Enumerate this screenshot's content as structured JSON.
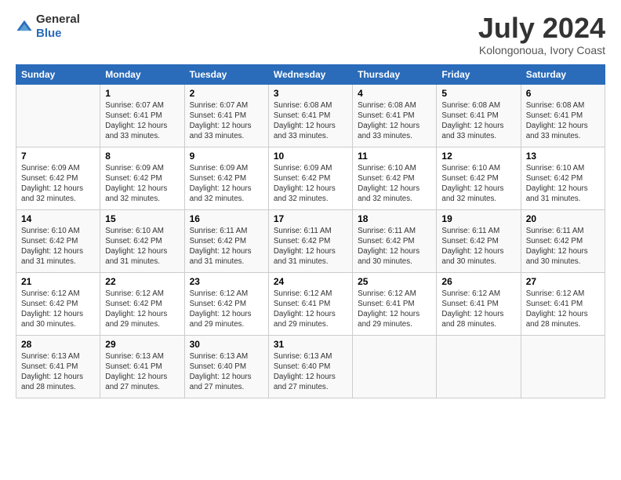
{
  "header": {
    "logo_general": "General",
    "logo_blue": "Blue",
    "title": "July 2024",
    "subtitle": "Kolongonoua, Ivory Coast"
  },
  "days_of_week": [
    "Sunday",
    "Monday",
    "Tuesday",
    "Wednesday",
    "Thursday",
    "Friday",
    "Saturday"
  ],
  "weeks": [
    [
      {
        "day": "",
        "sunrise": "",
        "sunset": "",
        "daylight": ""
      },
      {
        "day": "1",
        "sunrise": "Sunrise: 6:07 AM",
        "sunset": "Sunset: 6:41 PM",
        "daylight": "Daylight: 12 hours and 33 minutes."
      },
      {
        "day": "2",
        "sunrise": "Sunrise: 6:07 AM",
        "sunset": "Sunset: 6:41 PM",
        "daylight": "Daylight: 12 hours and 33 minutes."
      },
      {
        "day": "3",
        "sunrise": "Sunrise: 6:08 AM",
        "sunset": "Sunset: 6:41 PM",
        "daylight": "Daylight: 12 hours and 33 minutes."
      },
      {
        "day": "4",
        "sunrise": "Sunrise: 6:08 AM",
        "sunset": "Sunset: 6:41 PM",
        "daylight": "Daylight: 12 hours and 33 minutes."
      },
      {
        "day": "5",
        "sunrise": "Sunrise: 6:08 AM",
        "sunset": "Sunset: 6:41 PM",
        "daylight": "Daylight: 12 hours and 33 minutes."
      },
      {
        "day": "6",
        "sunrise": "Sunrise: 6:08 AM",
        "sunset": "Sunset: 6:41 PM",
        "daylight": "Daylight: 12 hours and 33 minutes."
      }
    ],
    [
      {
        "day": "7",
        "sunrise": "Sunrise: 6:09 AM",
        "sunset": "Sunset: 6:42 PM",
        "daylight": "Daylight: 12 hours and 32 minutes."
      },
      {
        "day": "8",
        "sunrise": "Sunrise: 6:09 AM",
        "sunset": "Sunset: 6:42 PM",
        "daylight": "Daylight: 12 hours and 32 minutes."
      },
      {
        "day": "9",
        "sunrise": "Sunrise: 6:09 AM",
        "sunset": "Sunset: 6:42 PM",
        "daylight": "Daylight: 12 hours and 32 minutes."
      },
      {
        "day": "10",
        "sunrise": "Sunrise: 6:09 AM",
        "sunset": "Sunset: 6:42 PM",
        "daylight": "Daylight: 12 hours and 32 minutes."
      },
      {
        "day": "11",
        "sunrise": "Sunrise: 6:10 AM",
        "sunset": "Sunset: 6:42 PM",
        "daylight": "Daylight: 12 hours and 32 minutes."
      },
      {
        "day": "12",
        "sunrise": "Sunrise: 6:10 AM",
        "sunset": "Sunset: 6:42 PM",
        "daylight": "Daylight: 12 hours and 32 minutes."
      },
      {
        "day": "13",
        "sunrise": "Sunrise: 6:10 AM",
        "sunset": "Sunset: 6:42 PM",
        "daylight": "Daylight: 12 hours and 31 minutes."
      }
    ],
    [
      {
        "day": "14",
        "sunrise": "Sunrise: 6:10 AM",
        "sunset": "Sunset: 6:42 PM",
        "daylight": "Daylight: 12 hours and 31 minutes."
      },
      {
        "day": "15",
        "sunrise": "Sunrise: 6:10 AM",
        "sunset": "Sunset: 6:42 PM",
        "daylight": "Daylight: 12 hours and 31 minutes."
      },
      {
        "day": "16",
        "sunrise": "Sunrise: 6:11 AM",
        "sunset": "Sunset: 6:42 PM",
        "daylight": "Daylight: 12 hours and 31 minutes."
      },
      {
        "day": "17",
        "sunrise": "Sunrise: 6:11 AM",
        "sunset": "Sunset: 6:42 PM",
        "daylight": "Daylight: 12 hours and 31 minutes."
      },
      {
        "day": "18",
        "sunrise": "Sunrise: 6:11 AM",
        "sunset": "Sunset: 6:42 PM",
        "daylight": "Daylight: 12 hours and 30 minutes."
      },
      {
        "day": "19",
        "sunrise": "Sunrise: 6:11 AM",
        "sunset": "Sunset: 6:42 PM",
        "daylight": "Daylight: 12 hours and 30 minutes."
      },
      {
        "day": "20",
        "sunrise": "Sunrise: 6:11 AM",
        "sunset": "Sunset: 6:42 PM",
        "daylight": "Daylight: 12 hours and 30 minutes."
      }
    ],
    [
      {
        "day": "21",
        "sunrise": "Sunrise: 6:12 AM",
        "sunset": "Sunset: 6:42 PM",
        "daylight": "Daylight: 12 hours and 30 minutes."
      },
      {
        "day": "22",
        "sunrise": "Sunrise: 6:12 AM",
        "sunset": "Sunset: 6:42 PM",
        "daylight": "Daylight: 12 hours and 29 minutes."
      },
      {
        "day": "23",
        "sunrise": "Sunrise: 6:12 AM",
        "sunset": "Sunset: 6:42 PM",
        "daylight": "Daylight: 12 hours and 29 minutes."
      },
      {
        "day": "24",
        "sunrise": "Sunrise: 6:12 AM",
        "sunset": "Sunset: 6:41 PM",
        "daylight": "Daylight: 12 hours and 29 minutes."
      },
      {
        "day": "25",
        "sunrise": "Sunrise: 6:12 AM",
        "sunset": "Sunset: 6:41 PM",
        "daylight": "Daylight: 12 hours and 29 minutes."
      },
      {
        "day": "26",
        "sunrise": "Sunrise: 6:12 AM",
        "sunset": "Sunset: 6:41 PM",
        "daylight": "Daylight: 12 hours and 28 minutes."
      },
      {
        "day": "27",
        "sunrise": "Sunrise: 6:12 AM",
        "sunset": "Sunset: 6:41 PM",
        "daylight": "Daylight: 12 hours and 28 minutes."
      }
    ],
    [
      {
        "day": "28",
        "sunrise": "Sunrise: 6:13 AM",
        "sunset": "Sunset: 6:41 PM",
        "daylight": "Daylight: 12 hours and 28 minutes."
      },
      {
        "day": "29",
        "sunrise": "Sunrise: 6:13 AM",
        "sunset": "Sunset: 6:41 PM",
        "daylight": "Daylight: 12 hours and 27 minutes."
      },
      {
        "day": "30",
        "sunrise": "Sunrise: 6:13 AM",
        "sunset": "Sunset: 6:40 PM",
        "daylight": "Daylight: 12 hours and 27 minutes."
      },
      {
        "day": "31",
        "sunrise": "Sunrise: 6:13 AM",
        "sunset": "Sunset: 6:40 PM",
        "daylight": "Daylight: 12 hours and 27 minutes."
      },
      {
        "day": "",
        "sunrise": "",
        "sunset": "",
        "daylight": ""
      },
      {
        "day": "",
        "sunrise": "",
        "sunset": "",
        "daylight": ""
      },
      {
        "day": "",
        "sunrise": "",
        "sunset": "",
        "daylight": ""
      }
    ]
  ]
}
